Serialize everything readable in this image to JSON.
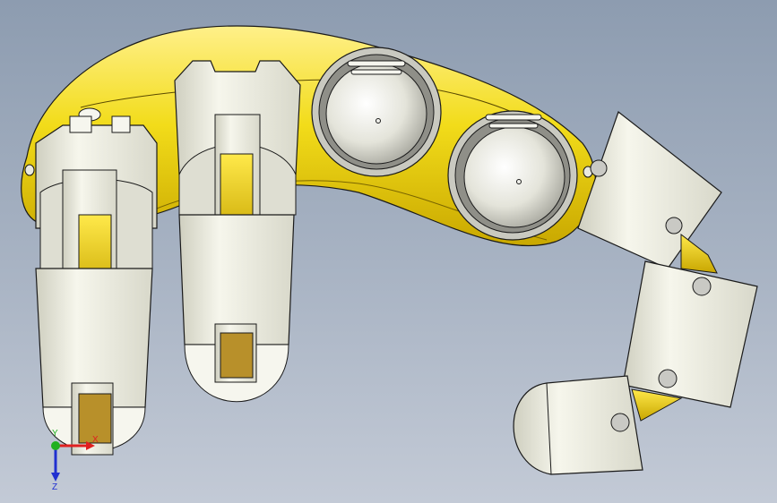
{
  "viewport": {
    "background_top": "#8d9cb0",
    "background_bottom": "#c3cad6"
  },
  "model": {
    "palm_color": "#f2dc1a",
    "palm_shadow": "#c9a800",
    "segment_color": "#ecece0",
    "segment_shade": "#d2d2c4",
    "edge_color": "#1a1a1a",
    "joint_slot_color": "#b8902a"
  },
  "triad": {
    "x_label": "X",
    "y_label": "Y",
    "z_label": "Z",
    "x_color": "#e02020",
    "y_color": "#20b020",
    "z_color": "#2030d0"
  }
}
